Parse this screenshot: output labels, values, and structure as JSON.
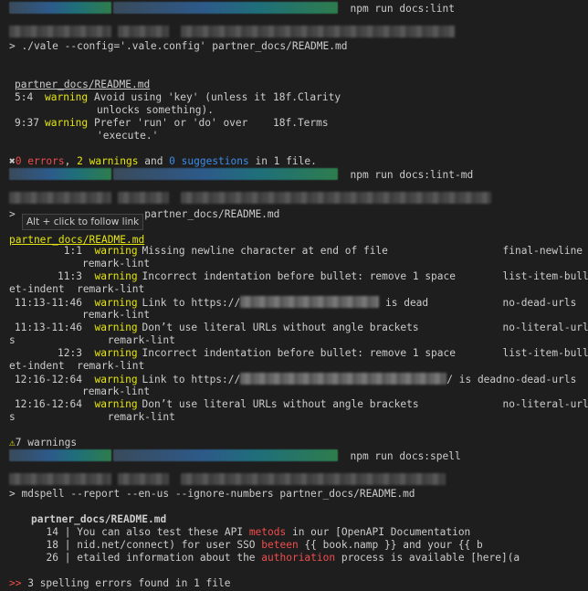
{
  "commands": {
    "lint": "npm run docs:lint",
    "lint_md": "npm run docs:lint-md",
    "spell": "npm run docs:spell"
  },
  "vale": {
    "cmd": "> ./vale --config='.vale.config' partner_docs/README.md",
    "file": "partner_docs/README.md",
    "rows": [
      {
        "pos": "5:4",
        "sev": "warning",
        "msg1": "Avoid using 'key' (unless it",
        "msg2": "unlocks something).",
        "rule": "18f.Clarity"
      },
      {
        "pos": "9:37",
        "sev": "warning",
        "msg1": "Prefer 'run' or 'do' over",
        "msg2": "'execute.'",
        "rule": "18f.Terms"
      }
    ],
    "summary_errors": "0 errors",
    "summary_mid1": ", ",
    "summary_warnings": "2 warnings",
    "summary_mid2": " and ",
    "summary_suggestions": "0 suggestions",
    "summary_tail": " in 1 file."
  },
  "remark": {
    "cmd_prefix": ">",
    "cmd_tail": "partner_docs/README.md",
    "tooltip": "Alt + click to follow link",
    "file": "partner_docs/README.md",
    "rows": [
      {
        "pos": "1:1",
        "sev": "warning",
        "msg": "Missing newline character at end of file",
        "rule": "final-newline",
        "wrap": "remark-lint"
      },
      {
        "pos": "11:3",
        "sev": "warning",
        "msg": "Incorrect indentation before bullet: remove 1 space",
        "rule": "list-item-bull",
        "wrap": "et-indent  remark-lint"
      },
      {
        "pos": "11:13-11:46",
        "sev": "warning",
        "msg": "Link to https://",
        "msg_tail": " is dead",
        "rule": "no-dead-urls",
        "wrap": "remark-lint"
      },
      {
        "pos": "11:13-11:46",
        "sev": "warning",
        "msg": "Don’t use literal URLs without angle brackets",
        "rule": "no-literal-url",
        "wrap": "s               remark-lint"
      },
      {
        "pos": "12:3",
        "sev": "warning",
        "msg": "Incorrect indentation before bullet: remove 1 space",
        "rule": "list-item-bull",
        "wrap": "et-indent  remark-lint"
      },
      {
        "pos": "12:16-12:64",
        "sev": "warning",
        "msg": "Link to https://",
        "msg_tail": "/ is dead",
        "rule": "no-dead-urls",
        "wrap": "remark-lint"
      },
      {
        "pos": "12:16-12:64",
        "sev": "warning",
        "msg": "Don’t use literal URLs without angle brackets",
        "rule": "no-literal-url",
        "wrap": "s               remark-lint"
      }
    ],
    "summary": "7 warnings"
  },
  "spell": {
    "cmd": "> mdspell --report --en-us --ignore-numbers partner_docs/README.md",
    "file": "partner_docs/README.md",
    "lines": [
      {
        "num": "14",
        "pre": " | You can also test these API ",
        "err": "metods",
        "post": " in our [OpenAPI Documentation"
      },
      {
        "num": "18",
        "pre": " | nid.net/connect) for user SSO ",
        "err": "beteen",
        "post": " {{ book.namp }} and your {{ b"
      },
      {
        "num": "26",
        "pre": " | etailed information about the ",
        "err": "authoriation",
        "post": " process is available [here](a"
      }
    ],
    "summary_marker": ">>",
    "summary": " 3 spelling errors found in 1 file"
  },
  "colors": {
    "background": "#1e1e1e",
    "warning": "#e5e510",
    "error": "#f14c4c",
    "info": "#3b8eea"
  }
}
